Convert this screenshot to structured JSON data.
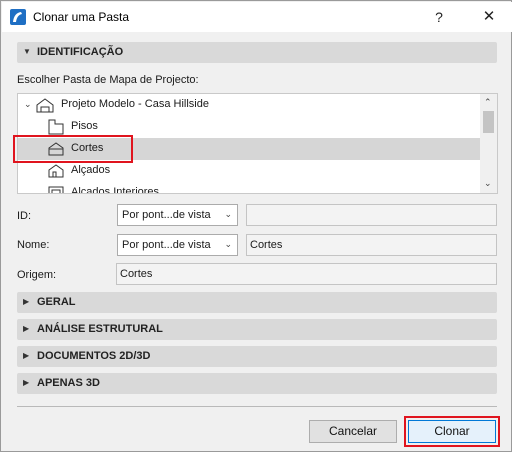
{
  "window": {
    "title": "Clonar uma Pasta",
    "help_label": "?",
    "close_label": "✕"
  },
  "identification": {
    "header": "IDENTIFICAÇÃO",
    "choose_label": "Escolher Pasta de Mapa de Projecto:",
    "tree": {
      "root": "Projeto Modelo - Casa Hillside",
      "items": [
        "Pisos",
        "Cortes",
        "Alçados",
        "Alçados Interiores"
      ],
      "selected": "Cortes"
    }
  },
  "fields": {
    "id_label": "ID:",
    "id_dropdown": "Por pont...de vista",
    "id_value": "",
    "name_label": "Nome:",
    "name_dropdown": "Por pont...de vista",
    "name_value": "Cortes",
    "origin_label": "Origem:",
    "origin_value": "Cortes"
  },
  "sections": [
    "GERAL",
    "ANÁLISE ESTRUTURAL",
    "DOCUMENTOS 2D/3D",
    "APENAS 3D"
  ],
  "buttons": {
    "cancel": "Cancelar",
    "clone": "Clonar"
  },
  "colors": {
    "highlight": "#e0141e",
    "accent": "#0078d7",
    "selection": "#d6d6d6"
  }
}
